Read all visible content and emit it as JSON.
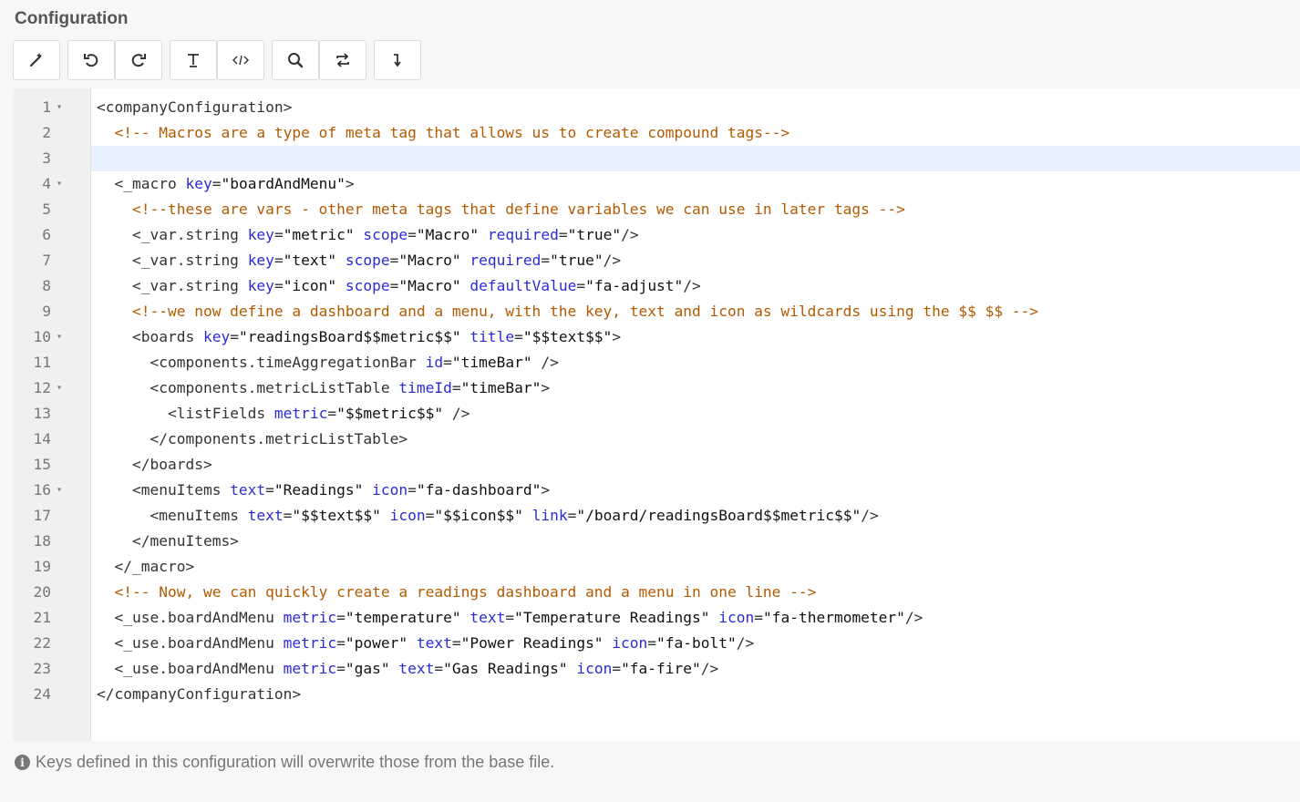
{
  "page": {
    "title": "Configuration"
  },
  "toolbar": {
    "buttons": [
      {
        "name": "magic-wand-icon",
        "title": "Format"
      },
      {
        "name": "undo-icon",
        "title": "Undo"
      },
      {
        "name": "redo-icon",
        "title": "Redo"
      },
      {
        "name": "text-format-icon",
        "title": "Text"
      },
      {
        "name": "code-icon",
        "title": "Code"
      },
      {
        "name": "search-icon",
        "title": "Search"
      },
      {
        "name": "replace-icon",
        "title": "Replace"
      },
      {
        "name": "goto-line-icon",
        "title": "Go to line"
      }
    ]
  },
  "editor": {
    "active_line": 3,
    "lines": [
      {
        "n": "1",
        "fold": true,
        "tokens": [
          [
            "tag",
            "<companyConfiguration>"
          ]
        ]
      },
      {
        "n": "2",
        "fold": false,
        "tokens": [
          [
            "txt",
            "  "
          ],
          [
            "com",
            "<!-- Macros are a type of meta tag that allows us to create compound tags-->"
          ]
        ]
      },
      {
        "n": "3",
        "fold": false,
        "tokens": []
      },
      {
        "n": "4",
        "fold": true,
        "tokens": [
          [
            "txt",
            "  "
          ],
          [
            "tag",
            "<_macro "
          ],
          [
            "attr",
            "key"
          ],
          [
            "tag",
            "="
          ],
          [
            "val",
            "\"boardAndMenu\""
          ],
          [
            "tag",
            ">"
          ]
        ]
      },
      {
        "n": "5",
        "fold": false,
        "tokens": [
          [
            "txt",
            "    "
          ],
          [
            "com",
            "<!--these are vars - other meta tags that define variables we can use in later tags -->"
          ]
        ]
      },
      {
        "n": "6",
        "fold": false,
        "tokens": [
          [
            "txt",
            "    "
          ],
          [
            "tag",
            "<_var.string "
          ],
          [
            "attr",
            "key"
          ],
          [
            "tag",
            "="
          ],
          [
            "val",
            "\"metric\""
          ],
          [
            "tag",
            " "
          ],
          [
            "attr",
            "scope"
          ],
          [
            "tag",
            "="
          ],
          [
            "val",
            "\"Macro\""
          ],
          [
            "tag",
            " "
          ],
          [
            "attr",
            "required"
          ],
          [
            "tag",
            "="
          ],
          [
            "val",
            "\"true\""
          ],
          [
            "tag",
            "/>"
          ]
        ]
      },
      {
        "n": "7",
        "fold": false,
        "tokens": [
          [
            "txt",
            "    "
          ],
          [
            "tag",
            "<_var.string "
          ],
          [
            "attr",
            "key"
          ],
          [
            "tag",
            "="
          ],
          [
            "val",
            "\"text\""
          ],
          [
            "tag",
            " "
          ],
          [
            "attr",
            "scope"
          ],
          [
            "tag",
            "="
          ],
          [
            "val",
            "\"Macro\""
          ],
          [
            "tag",
            " "
          ],
          [
            "attr",
            "required"
          ],
          [
            "tag",
            "="
          ],
          [
            "val",
            "\"true\""
          ],
          [
            "tag",
            "/>"
          ]
        ]
      },
      {
        "n": "8",
        "fold": false,
        "tokens": [
          [
            "txt",
            "    "
          ],
          [
            "tag",
            "<_var.string "
          ],
          [
            "attr",
            "key"
          ],
          [
            "tag",
            "="
          ],
          [
            "val",
            "\"icon\""
          ],
          [
            "tag",
            " "
          ],
          [
            "attr",
            "scope"
          ],
          [
            "tag",
            "="
          ],
          [
            "val",
            "\"Macro\""
          ],
          [
            "tag",
            " "
          ],
          [
            "attr",
            "defaultValue"
          ],
          [
            "tag",
            "="
          ],
          [
            "val",
            "\"fa-adjust\""
          ],
          [
            "tag",
            "/>"
          ]
        ]
      },
      {
        "n": "9",
        "fold": false,
        "tokens": [
          [
            "txt",
            "    "
          ],
          [
            "com",
            "<!--we now define a dashboard and a menu, with the key, text and icon as wildcards using the $$ $$ -->"
          ]
        ]
      },
      {
        "n": "10",
        "fold": true,
        "tokens": [
          [
            "txt",
            "    "
          ],
          [
            "tag",
            "<boards "
          ],
          [
            "attr",
            "key"
          ],
          [
            "tag",
            "="
          ],
          [
            "val",
            "\"readingsBoard$$metric$$\""
          ],
          [
            "tag",
            " "
          ],
          [
            "attr",
            "title"
          ],
          [
            "tag",
            "="
          ],
          [
            "val",
            "\"$$text$$\""
          ],
          [
            "tag",
            ">"
          ]
        ]
      },
      {
        "n": "11",
        "fold": false,
        "tokens": [
          [
            "txt",
            "      "
          ],
          [
            "tag",
            "<components.timeAggregationBar "
          ],
          [
            "attr",
            "id"
          ],
          [
            "tag",
            "="
          ],
          [
            "val",
            "\"timeBar\""
          ],
          [
            "tag",
            " />"
          ]
        ]
      },
      {
        "n": "12",
        "fold": true,
        "tokens": [
          [
            "txt",
            "      "
          ],
          [
            "tag",
            "<components.metricListTable "
          ],
          [
            "attr",
            "timeId"
          ],
          [
            "tag",
            "="
          ],
          [
            "val",
            "\"timeBar\""
          ],
          [
            "tag",
            ">"
          ]
        ]
      },
      {
        "n": "13",
        "fold": false,
        "tokens": [
          [
            "txt",
            "        "
          ],
          [
            "tag",
            "<listFields "
          ],
          [
            "attr",
            "metric"
          ],
          [
            "tag",
            "="
          ],
          [
            "val",
            "\"$$metric$$\""
          ],
          [
            "tag",
            " />"
          ]
        ]
      },
      {
        "n": "14",
        "fold": false,
        "tokens": [
          [
            "txt",
            "      "
          ],
          [
            "tag",
            "</components.metricListTable>"
          ]
        ]
      },
      {
        "n": "15",
        "fold": false,
        "tokens": [
          [
            "txt",
            "    "
          ],
          [
            "tag",
            "</boards>"
          ]
        ]
      },
      {
        "n": "16",
        "fold": true,
        "tokens": [
          [
            "txt",
            "    "
          ],
          [
            "tag",
            "<menuItems "
          ],
          [
            "attr",
            "text"
          ],
          [
            "tag",
            "="
          ],
          [
            "val",
            "\"Readings\""
          ],
          [
            "tag",
            " "
          ],
          [
            "attr",
            "icon"
          ],
          [
            "tag",
            "="
          ],
          [
            "val",
            "\"fa-dashboard\""
          ],
          [
            "tag",
            ">"
          ]
        ]
      },
      {
        "n": "17",
        "fold": false,
        "tokens": [
          [
            "txt",
            "      "
          ],
          [
            "tag",
            "<menuItems "
          ],
          [
            "attr",
            "text"
          ],
          [
            "tag",
            "="
          ],
          [
            "val",
            "\"$$text$$\""
          ],
          [
            "tag",
            " "
          ],
          [
            "attr",
            "icon"
          ],
          [
            "tag",
            "="
          ],
          [
            "val",
            "\"$$icon$$\""
          ],
          [
            "tag",
            " "
          ],
          [
            "attr",
            "link"
          ],
          [
            "tag",
            "="
          ],
          [
            "val",
            "\"/board/readingsBoard$$metric$$\""
          ],
          [
            "tag",
            "/>"
          ]
        ]
      },
      {
        "n": "18",
        "fold": false,
        "tokens": [
          [
            "txt",
            "    "
          ],
          [
            "tag",
            "</menuItems>"
          ]
        ]
      },
      {
        "n": "19",
        "fold": false,
        "tokens": [
          [
            "txt",
            "  "
          ],
          [
            "tag",
            "</_macro>"
          ]
        ]
      },
      {
        "n": "20",
        "fold": false,
        "tokens": [
          [
            "txt",
            "  "
          ],
          [
            "com",
            "<!-- Now, we can quickly create a readings dashboard and a menu in one line -->"
          ]
        ]
      },
      {
        "n": "21",
        "fold": false,
        "tokens": [
          [
            "txt",
            "  "
          ],
          [
            "tag",
            "<_use.boardAndMenu "
          ],
          [
            "attr",
            "metric"
          ],
          [
            "tag",
            "="
          ],
          [
            "val",
            "\"temperature\""
          ],
          [
            "tag",
            " "
          ],
          [
            "attr",
            "text"
          ],
          [
            "tag",
            "="
          ],
          [
            "val",
            "\"Temperature Readings\""
          ],
          [
            "tag",
            " "
          ],
          [
            "attr",
            "icon"
          ],
          [
            "tag",
            "="
          ],
          [
            "val",
            "\"fa-thermometer\""
          ],
          [
            "tag",
            "/>"
          ]
        ]
      },
      {
        "n": "22",
        "fold": false,
        "tokens": [
          [
            "txt",
            "  "
          ],
          [
            "tag",
            "<_use.boardAndMenu "
          ],
          [
            "attr",
            "metric"
          ],
          [
            "tag",
            "="
          ],
          [
            "val",
            "\"power\""
          ],
          [
            "tag",
            " "
          ],
          [
            "attr",
            "text"
          ],
          [
            "tag",
            "="
          ],
          [
            "val",
            "\"Power Readings\""
          ],
          [
            "tag",
            " "
          ],
          [
            "attr",
            "icon"
          ],
          [
            "tag",
            "="
          ],
          [
            "val",
            "\"fa-bolt\""
          ],
          [
            "tag",
            "/>"
          ]
        ]
      },
      {
        "n": "23",
        "fold": false,
        "tokens": [
          [
            "txt",
            "  "
          ],
          [
            "tag",
            "<_use.boardAndMenu "
          ],
          [
            "attr",
            "metric"
          ],
          [
            "tag",
            "="
          ],
          [
            "val",
            "\"gas\""
          ],
          [
            "tag",
            " "
          ],
          [
            "attr",
            "text"
          ],
          [
            "tag",
            "="
          ],
          [
            "val",
            "\"Gas Readings\""
          ],
          [
            "tag",
            " "
          ],
          [
            "attr",
            "icon"
          ],
          [
            "tag",
            "="
          ],
          [
            "val",
            "\"fa-fire\""
          ],
          [
            "tag",
            "/>"
          ]
        ]
      },
      {
        "n": "24",
        "fold": false,
        "tokens": [
          [
            "tag",
            "</companyConfiguration>"
          ]
        ]
      }
    ]
  },
  "info": {
    "text": "Keys defined in this configuration will overwrite those from the base file."
  }
}
